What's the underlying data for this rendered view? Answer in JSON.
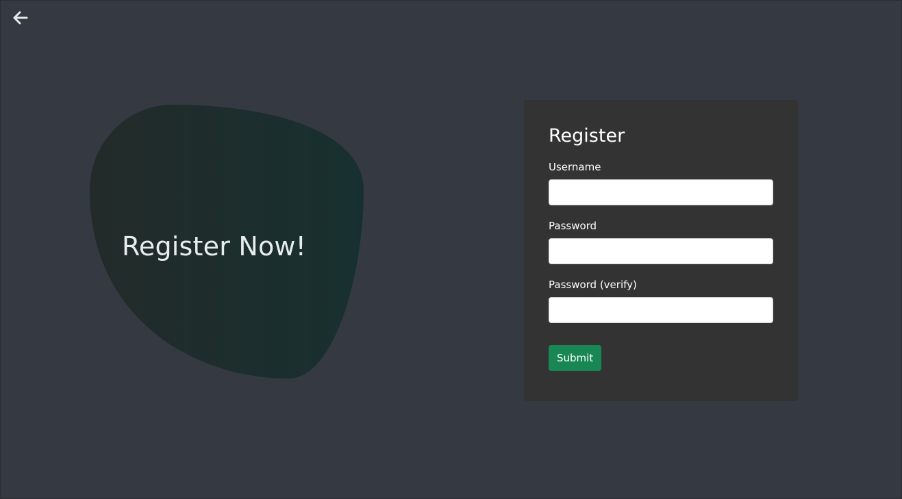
{
  "nav": {
    "back_icon": "arrow-left-icon"
  },
  "hero": {
    "text": "Register Now!"
  },
  "form": {
    "title": "Register",
    "fields": [
      {
        "label": "Username",
        "value": "",
        "placeholder": ""
      },
      {
        "label": "Password",
        "value": "",
        "placeholder": ""
      },
      {
        "label": "Password (verify)",
        "value": "",
        "placeholder": ""
      }
    ],
    "submit_label": "Submit"
  },
  "colors": {
    "background": "#353941",
    "card": "#333333",
    "accent": "#198754",
    "blob_start": "#232b2a",
    "blob_end": "#17302f"
  }
}
